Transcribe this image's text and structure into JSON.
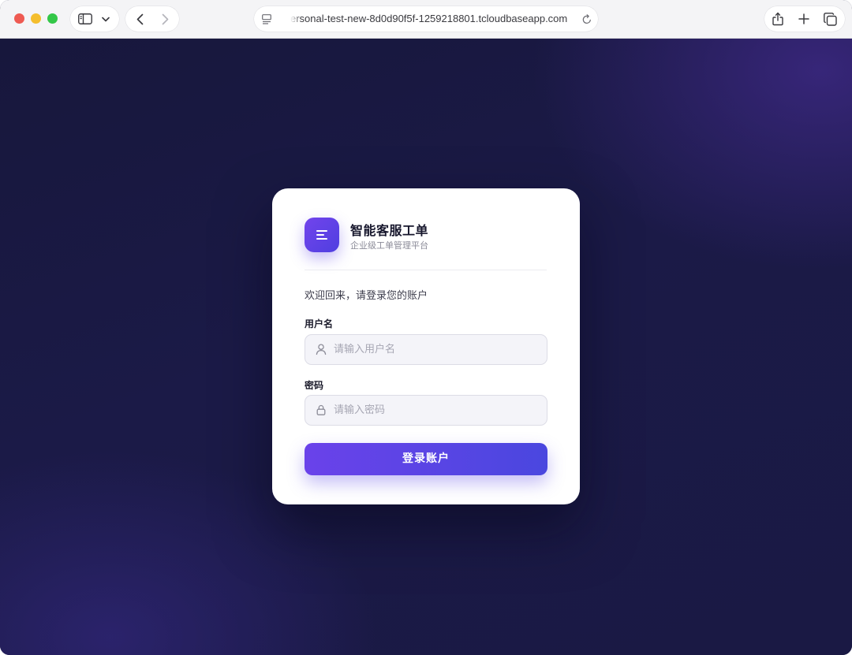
{
  "browser": {
    "url": "ersonal-test-new-8d0d90f5f-1259218801.tcloudbaseapp.com",
    "icons": [
      "sidebar-icon",
      "chevron-down-icon",
      "back-icon",
      "forward-icon",
      "page-icon",
      "reload-icon",
      "share-icon",
      "plus-icon",
      "tabs-icon"
    ]
  },
  "brand": {
    "title": "智能客服工单",
    "subtitle": "企业级工单管理平台"
  },
  "login": {
    "welcome": "欢迎回来，请登录您的账户",
    "username_label": "用户名",
    "username_placeholder": "请输入用户名",
    "password_label": "密码",
    "password_placeholder": "请输入密码",
    "submit_label": "登录账户"
  },
  "colors": {
    "accent": "#5b44e6",
    "background": "#17173c"
  }
}
